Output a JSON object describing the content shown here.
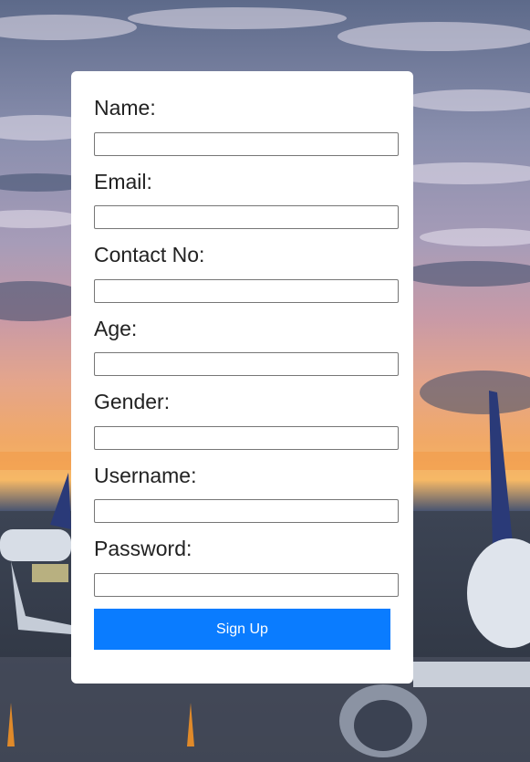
{
  "form": {
    "fields": [
      {
        "label": "Name:",
        "value": ""
      },
      {
        "label": "Email:",
        "value": ""
      },
      {
        "label": "Contact No:",
        "value": ""
      },
      {
        "label": "Age:",
        "value": ""
      },
      {
        "label": "Gender:",
        "value": ""
      },
      {
        "label": "Username:",
        "value": ""
      },
      {
        "label": "Password:",
        "value": ""
      }
    ],
    "submit_label": "Sign Up"
  },
  "colors": {
    "button": "#0a7cff",
    "card": "#ffffff"
  }
}
